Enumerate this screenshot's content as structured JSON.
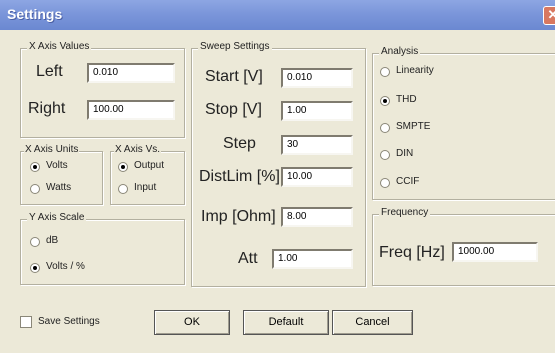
{
  "window": {
    "title": "Settings",
    "close_glyph": "✕"
  },
  "x_axis_values": {
    "title": "X Axis Values",
    "left_label": "Left",
    "left_value": "0.010",
    "right_label": "Right",
    "right_value": "100.00"
  },
  "x_axis_units": {
    "title": "X Axis Units",
    "options": [
      "Volts",
      "Watts"
    ],
    "selected": "Volts"
  },
  "x_axis_vs": {
    "title": "X Axis Vs.",
    "options": [
      "Output",
      "Input"
    ],
    "selected": "Output"
  },
  "y_axis_scale": {
    "title": "Y Axis Scale",
    "options": [
      "dB",
      "Volts / %"
    ],
    "selected": "Volts / %"
  },
  "sweep": {
    "title": "Sweep Settings",
    "start_label": "Start [V]",
    "start_value": "0.010",
    "stop_label": "Stop [V]",
    "stop_value": "1.00",
    "step_label": "Step",
    "step_value": "30",
    "distlim_label": "DistLim [%]",
    "distlim_value": "10.00",
    "imp_label": "Imp [Ohm]",
    "imp_value": "8.00",
    "att_label": "Att",
    "att_value": "1.00"
  },
  "analysis": {
    "title": "Analysis",
    "options": [
      "Linearity",
      "THD",
      "SMPTE",
      "DIN",
      "CCIF"
    ],
    "selected": "THD"
  },
  "frequency": {
    "title": "Frequency",
    "freq_label": "Freq [Hz]",
    "freq_value": "1000.00"
  },
  "save_settings": {
    "label": "Save Settings",
    "checked": false
  },
  "buttons": {
    "ok": "OK",
    "default": "Default",
    "cancel": "Cancel"
  }
}
